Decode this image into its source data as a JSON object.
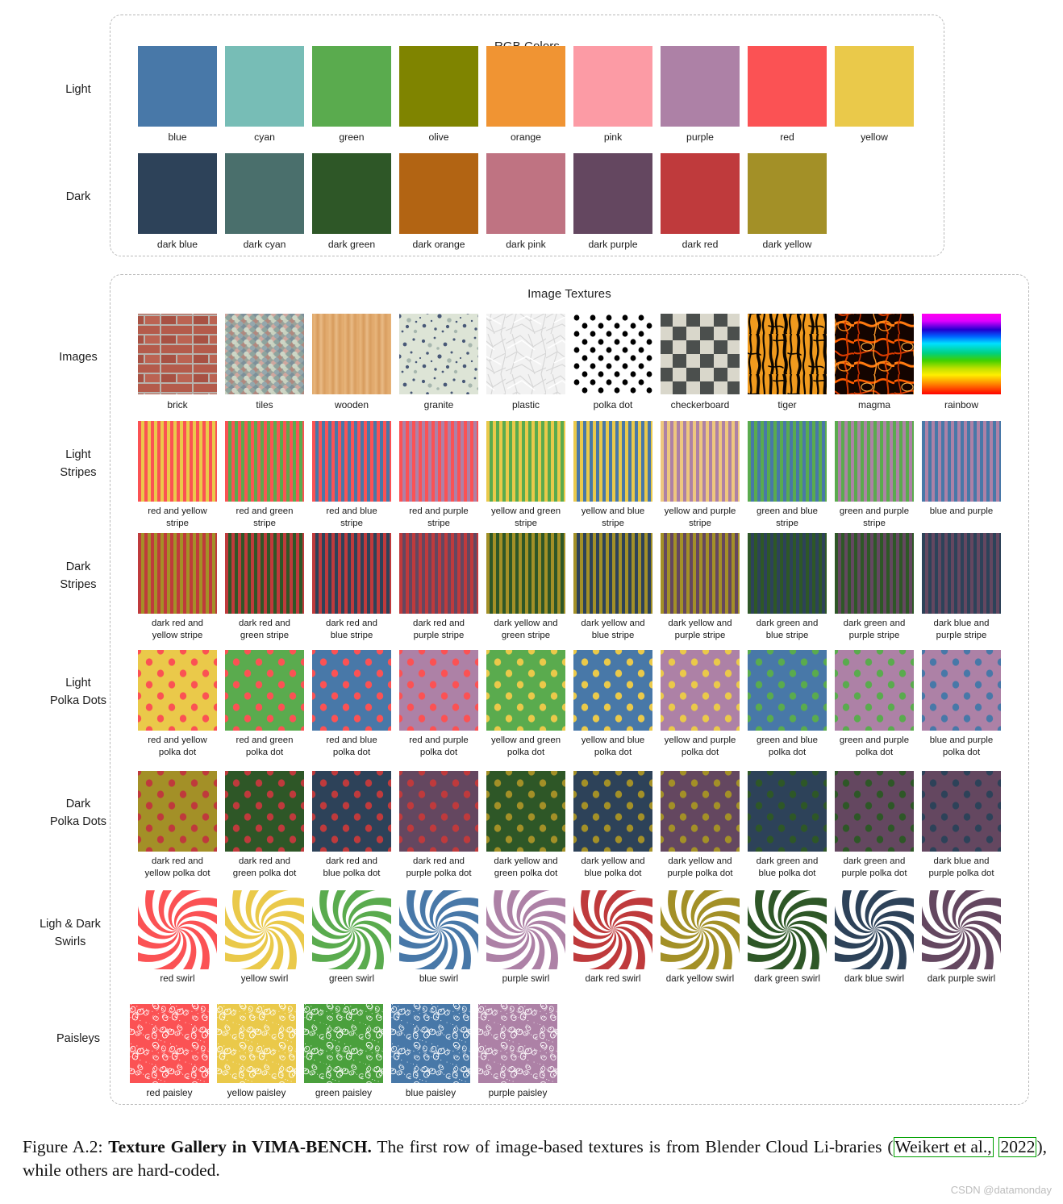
{
  "figure": {
    "label": "Figure A.2:",
    "title_bold": "Texture Gallery in VIMA-B",
    "title_sc": "ENCH",
    "title_dot": ".",
    "body_1": "The first row of image-based textures is from Blender Cloud Li-braries (",
    "cite_author": "Weikert et al.,",
    "cite_year": "2022",
    "body_2": "), while others are hard-coded.",
    "watermark": "CSDN @datamonday"
  },
  "panels": {
    "rgb": {
      "title": "RGB Colors"
    },
    "textures": {
      "title": "Image Textures"
    }
  },
  "rows": {
    "light": {
      "label": "Light"
    },
    "dark": {
      "label": "Dark"
    },
    "images": {
      "label": "Images"
    },
    "light_stripes": {
      "label": "Light\nStripes"
    },
    "dark_stripes": {
      "label": "Dark\nStripes"
    },
    "light_polka": {
      "label": "Light\nPolka Dots"
    },
    "dark_polka": {
      "label": "Dark\nPolka Dots"
    },
    "swirls": {
      "label": "Ligh & Dark\nSwirls"
    },
    "paisleys": {
      "label": "Paisleys"
    }
  },
  "palette": {
    "blue": "#4878a8",
    "cyan": "#77bdb6",
    "green": "#5aab4e",
    "olive": "#7f8400",
    "orange": "#f09433",
    "pink": "#fc9ba5",
    "purple": "#ad81a6",
    "red": "#fb5254",
    "yellow": "#eac94a",
    "dark_blue": "#2d4259",
    "dark_cyan": "#4a6f6c",
    "dark_green": "#2e5727",
    "dark_orange": "#b26413",
    "dark_pink": "#bf7382",
    "dark_purple": "#644760",
    "dark_red": "#bf3a3c",
    "dark_yellow": "#a39027",
    "white": "#ffffff"
  },
  "rgb_colors": {
    "light": [
      {
        "name": "blue",
        "color": "#4878a8"
      },
      {
        "name": "cyan",
        "color": "#77bdb6"
      },
      {
        "name": "green",
        "color": "#5aab4e"
      },
      {
        "name": "olive",
        "color": "#7f8400"
      },
      {
        "name": "orange",
        "color": "#f09433"
      },
      {
        "name": "pink",
        "color": "#fc9ba5"
      },
      {
        "name": "purple",
        "color": "#ad81a6"
      },
      {
        "name": "red",
        "color": "#fb5254"
      },
      {
        "name": "yellow",
        "color": "#eac94a"
      }
    ],
    "dark": [
      {
        "name": "dark blue",
        "color": "#2d4259"
      },
      {
        "name": "dark cyan",
        "color": "#4a6f6c"
      },
      {
        "name": "dark green",
        "color": "#2e5727"
      },
      {
        "name": "dark orange",
        "color": "#b26413"
      },
      {
        "name": "dark pink",
        "color": "#bf7382"
      },
      {
        "name": "dark purple",
        "color": "#644760"
      },
      {
        "name": "dark red",
        "color": "#bf3a3c"
      },
      {
        "name": "dark yellow",
        "color": "#a39027"
      }
    ]
  },
  "image_textures": [
    {
      "name": "brick",
      "kind": "brick"
    },
    {
      "name": "tiles",
      "kind": "tiles"
    },
    {
      "name": "wooden",
      "kind": "wooden"
    },
    {
      "name": "granite",
      "kind": "granite"
    },
    {
      "name": "plastic",
      "kind": "plastic"
    },
    {
      "name": "polka dot",
      "kind": "polkadot_bw"
    },
    {
      "name": "checkerboard",
      "kind": "checkerboard"
    },
    {
      "name": "tiger",
      "kind": "tiger"
    },
    {
      "name": "magma",
      "kind": "magma"
    },
    {
      "name": "rainbow",
      "kind": "rainbow"
    }
  ],
  "light_stripes": [
    {
      "name": "red and yellow\nstripe",
      "a": "#fb5254",
      "b": "#eac94a"
    },
    {
      "name": "red and green\nstripe",
      "a": "#fb5254",
      "b": "#5aab4e"
    },
    {
      "name": "red and blue\nstripe",
      "a": "#fb5254",
      "b": "#4878a8"
    },
    {
      "name": "red and purple\nstripe",
      "a": "#fb5254",
      "b": "#ad81a6"
    },
    {
      "name": "yellow and green\nstripe",
      "a": "#eac94a",
      "b": "#5aab4e"
    },
    {
      "name": "yellow and blue\nstripe",
      "a": "#eac94a",
      "b": "#4878a8"
    },
    {
      "name": "yellow and purple\nstripe",
      "a": "#eec77e",
      "b": "#ad81a6"
    },
    {
      "name": "green and blue\nstripe",
      "a": "#5aab4e",
      "b": "#4878a8"
    },
    {
      "name": "green and purple\nstripe",
      "a": "#5aab4e",
      "b": "#ad81a6"
    },
    {
      "name": "blue and purple",
      "a": "#4878a8",
      "b": "#ad81a6"
    }
  ],
  "dark_stripes": [
    {
      "name": "dark red and\nyellow stripe",
      "a": "#bf3a3c",
      "b": "#a39027"
    },
    {
      "name": "dark red and\ngreen stripe",
      "a": "#bf3a3c",
      "b": "#2e5727"
    },
    {
      "name": "dark red and\nblue stripe",
      "a": "#bf3a3c",
      "b": "#2d4259"
    },
    {
      "name": "dark red and\npurple stripe",
      "a": "#bf3a3c",
      "b": "#644760"
    },
    {
      "name": "dark yellow and\ngreen stripe",
      "a": "#a39027",
      "b": "#2e5727"
    },
    {
      "name": "dark yellow and\nblue stripe",
      "a": "#a39027",
      "b": "#2d4259"
    },
    {
      "name": "dark yellow and\npurple stripe",
      "a": "#a39027",
      "b": "#644760"
    },
    {
      "name": "dark green and\nblue stripe",
      "a": "#2e5727",
      "b": "#2d4259"
    },
    {
      "name": "dark green and\npurple stripe",
      "a": "#2e5727",
      "b": "#644760"
    },
    {
      "name": "dark blue and\npurple stripe",
      "a": "#2d4259",
      "b": "#644760"
    }
  ],
  "light_polka": [
    {
      "name": "red and yellow\npolka dot",
      "dot": "#fb5254",
      "bg": "#eac94a"
    },
    {
      "name": "red and green\npolka dot",
      "dot": "#fb5254",
      "bg": "#5aab4e"
    },
    {
      "name": "red and blue\npolka dot",
      "dot": "#fb5254",
      "bg": "#4878a8"
    },
    {
      "name": "red and purple\npolka dot",
      "dot": "#fb5254",
      "bg": "#ad81a6"
    },
    {
      "name": "yellow and green\npolka dot",
      "dot": "#eac94a",
      "bg": "#5aab4e"
    },
    {
      "name": "yellow and blue\npolka dot",
      "dot": "#eac94a",
      "bg": "#4878a8"
    },
    {
      "name": "yellow and purple\npolka dot",
      "dot": "#eac94a",
      "bg": "#ad81a6"
    },
    {
      "name": "green and blue\npolka dot",
      "dot": "#5aab4e",
      "bg": "#4878a8"
    },
    {
      "name": "green and purple\npolka dot",
      "dot": "#5aab4e",
      "bg": "#ad81a6"
    },
    {
      "name": "blue and purple\npolka dot",
      "dot": "#4878a8",
      "bg": "#ad81a6"
    }
  ],
  "dark_polka": [
    {
      "name": "dark red and\nyellow polka dot",
      "dot": "#bf3a3c",
      "bg": "#a39027"
    },
    {
      "name": "dark red and\ngreen polka dot",
      "dot": "#bf3a3c",
      "bg": "#2e5727"
    },
    {
      "name": "dark red and\nblue polka dot",
      "dot": "#bf3a3c",
      "bg": "#2d4259"
    },
    {
      "name": "dark red and\npurple polka dot",
      "dot": "#bf3a3c",
      "bg": "#644760"
    },
    {
      "name": "dark yellow and\ngreen polka dot",
      "dot": "#a39027",
      "bg": "#2e5727"
    },
    {
      "name": "dark yellow and\nblue polka dot",
      "dot": "#a39027",
      "bg": "#2d4259"
    },
    {
      "name": "dark yellow and\npurple polka dot",
      "dot": "#a39027",
      "bg": "#644760"
    },
    {
      "name": "dark green and\nblue polka dot",
      "dot": "#2e5727",
      "bg": "#2d4259"
    },
    {
      "name": "dark green and\npurple polka dot",
      "dot": "#2e5727",
      "bg": "#644760"
    },
    {
      "name": "dark blue and\npurple polka dot",
      "dot": "#2d4259",
      "bg": "#644760"
    }
  ],
  "swirls": [
    {
      "name": "red swirl",
      "color": "#fb5254"
    },
    {
      "name": "yellow swirl",
      "color": "#eac94a"
    },
    {
      "name": "green swirl",
      "color": "#5aab4e"
    },
    {
      "name": "blue swirl",
      "color": "#4878a8"
    },
    {
      "name": "purple swirl",
      "color": "#ad81a6"
    },
    {
      "name": "dark red swirl",
      "color": "#bf3a3c"
    },
    {
      "name": "dark yellow swirl",
      "color": "#a39027"
    },
    {
      "name": "dark green swirl",
      "color": "#2e5727"
    },
    {
      "name": "dark blue swirl",
      "color": "#2d4259"
    },
    {
      "name": "dark purple swirl",
      "color": "#644760"
    }
  ],
  "paisleys": [
    {
      "name": "red paisley",
      "color": "#fb5254"
    },
    {
      "name": "yellow paisley",
      "color": "#eac94a"
    },
    {
      "name": "green paisley",
      "color": "#4aa03c"
    },
    {
      "name": "blue paisley",
      "color": "#4878a8"
    },
    {
      "name": "purple paisley",
      "color": "#ad81a6"
    }
  ]
}
